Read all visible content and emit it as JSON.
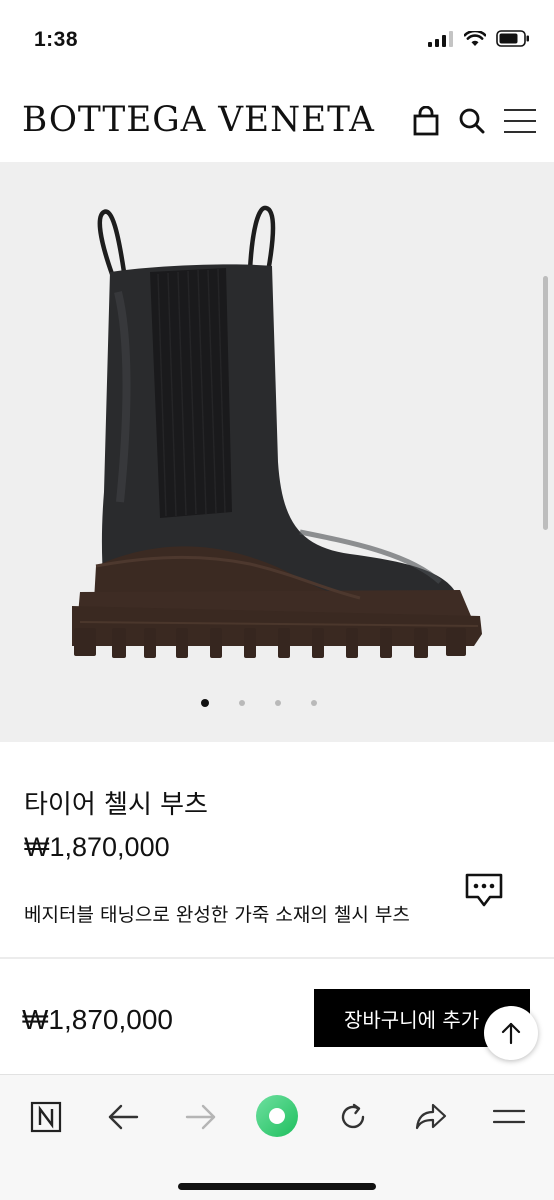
{
  "status_bar": {
    "time": "1:38"
  },
  "header": {
    "brand": "BOTTEGA VENETA",
    "icons": [
      "shopping-bag-icon",
      "search-icon",
      "menu-icon"
    ]
  },
  "gallery": {
    "page_count": 4,
    "active_index": 0,
    "background": "#efefef"
  },
  "product": {
    "name": "타이어 첼시 부츠",
    "price": "₩1,870,000",
    "description": "베지터블 태닝으로 완성한 가죽 소재의 첼시 부츠"
  },
  "buy_bar": {
    "price": "₩1,870,000",
    "add_to_cart_label": "장바구니에 추가"
  },
  "browser_toolbar": {
    "items": [
      "naver-icon",
      "back-arrow-icon",
      "forward-arrow-icon",
      "green-home-icon",
      "reload-icon",
      "share-icon",
      "menu-icon"
    ],
    "accent": "#2ecc71"
  }
}
